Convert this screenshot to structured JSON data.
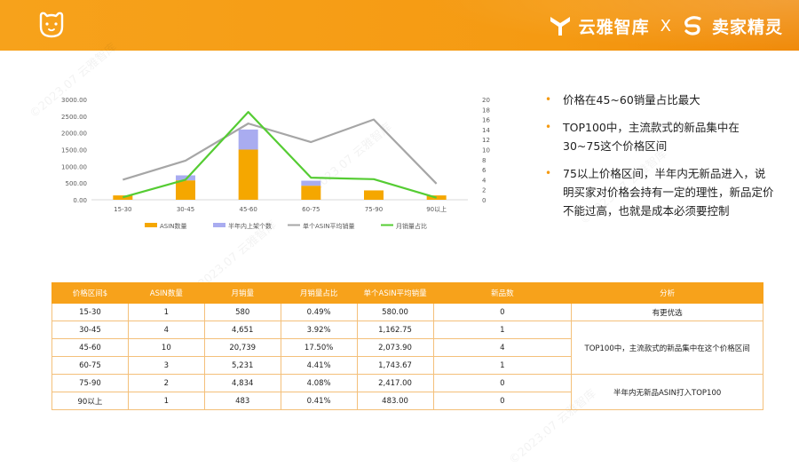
{
  "header": {
    "brand_yunya": "云雅智库",
    "separator": "X",
    "brand_maijia": "卖家精灵"
  },
  "watermark": "©2023.07 云雅智库",
  "chart_data": {
    "type": "bar",
    "categories": [
      "15-30",
      "30-45",
      "45-60",
      "60-75",
      "75-90",
      "90以上"
    ],
    "series": [
      {
        "name": "ASIN数量",
        "kind": "bar",
        "axis": "left",
        "color": "#f5a700",
        "values": [
          130,
          580,
          1500,
          420,
          280,
          130
        ]
      },
      {
        "name": "半年内上架个数",
        "kind": "bar",
        "axis": "left",
        "color": "#a9acf0",
        "values": [
          0,
          150,
          600,
          150,
          0,
          0
        ]
      },
      {
        "name": "单个ASIN平均销量",
        "kind": "line",
        "axis": "right",
        "color": "#a6a6a6",
        "values": [
          4,
          7.8,
          15.2,
          11.5,
          16,
          3.2
        ]
      },
      {
        "name": "月销量占比",
        "kind": "line",
        "axis": "right",
        "color": "#55cc33",
        "values": [
          0.5,
          4,
          17.5,
          4.4,
          4.1,
          0.4
        ]
      }
    ],
    "y_left_ticks": [
      "0.00",
      "500.00",
      "1000.00",
      "1500.00",
      "2000.00",
      "2500.00",
      "3000.00"
    ],
    "y_left_range": [
      0,
      3000
    ],
    "y_right_ticks": [
      "0",
      "2",
      "4",
      "6",
      "8",
      "10",
      "12",
      "14",
      "16",
      "18",
      "20"
    ],
    "y_right_range": [
      0,
      20
    ],
    "legend_position": "bottom"
  },
  "bullets": [
    "价格在45~60销量占比最大",
    "TOP100中，主流款式的新品集中在30~75这个价格区间",
    "75以上价格区间，半年内无新品进入，说明买家对价格会持有一定的理性，新品定价不能过高，也就是成本必须要控制"
  ],
  "table": {
    "headers": [
      "价格区间$",
      "ASIN数量",
      "月销量",
      "月销量占比",
      "单个ASIN平均销量",
      "新品数",
      "分析"
    ],
    "rows": [
      [
        "15-30",
        "1",
        "580",
        "0.49%",
        "580.00",
        "0"
      ],
      [
        "30-45",
        "4",
        "4,651",
        "3.92%",
        "1,162.75",
        "1"
      ],
      [
        "45-60",
        "10",
        "20,739",
        "17.50%",
        "2,073.90",
        "4"
      ],
      [
        "60-75",
        "3",
        "5,231",
        "4.41%",
        "1,743.67",
        "1"
      ],
      [
        "75-90",
        "2",
        "4,834",
        "4.08%",
        "2,417.00",
        "0"
      ],
      [
        "90以上",
        "1",
        "483",
        "0.41%",
        "483.00",
        "0"
      ]
    ],
    "analysis": [
      "有更优选",
      "TOP100中，主流款式的新品集中在这个价格区间",
      "半年内无新品ASIN打入TOP100"
    ]
  },
  "colors": {
    "accent": "#f7a21b",
    "border": "#f4c07a"
  }
}
